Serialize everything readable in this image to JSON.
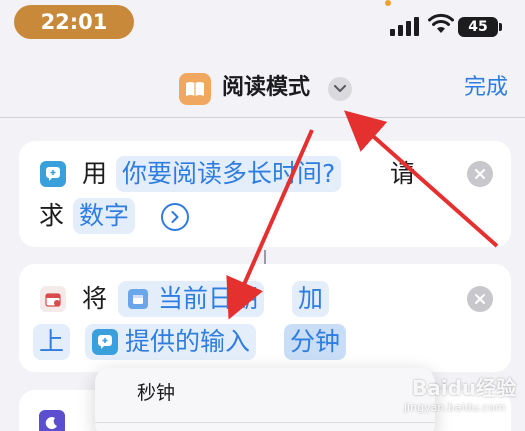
{
  "status_bar": {
    "time": "22:01",
    "battery": "45",
    "time_pill_color": "#c8893a"
  },
  "nav": {
    "title": "阅读模式",
    "done_label": "完成",
    "app_icon": "book-icon",
    "accent": "#2f7de0"
  },
  "actions": [
    {
      "icon": "ask-for-input-icon",
      "prefix": "用",
      "prompt": "你要阅读多长时间?",
      "word_a": "请",
      "word_b": "求",
      "type": "数字"
    },
    {
      "icon": "calendar-icon",
      "prefix": "将",
      "date_var": "当前日期",
      "op_a": "加",
      "op_b": "上",
      "input_var": "提供的输入",
      "unit": "分钟"
    }
  ],
  "unit_menu": {
    "items": [
      "秒钟"
    ]
  },
  "watermark": {
    "brand": "Baidu经验",
    "url": "jingyan.baidu.com"
  }
}
